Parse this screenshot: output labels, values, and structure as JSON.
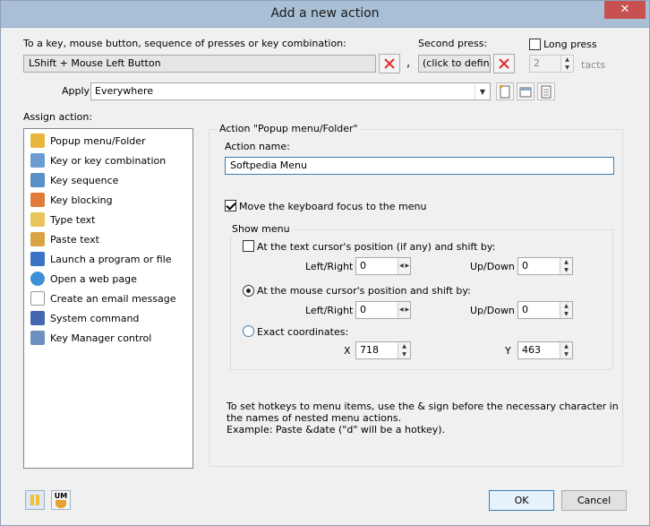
{
  "window": {
    "title": "Add a new action",
    "close_glyph": "✕"
  },
  "key": {
    "label": "To a key, mouse button, sequence of presses or key combination:",
    "value": "LShift + Mouse Left Button",
    "separator": ","
  },
  "second_press": {
    "label": "Second press:",
    "value": "(click to define)"
  },
  "long_press": {
    "label": "Long press",
    "checked": false,
    "tacts_value": "2",
    "tacts_label": "tacts"
  },
  "apply": {
    "label": "Apply",
    "value": "Everywhere"
  },
  "assign": {
    "label": "Assign action:",
    "items": [
      {
        "label": "Popup menu/Folder",
        "icon": "folder-icon",
        "color": "#e8b63c"
      },
      {
        "label": "Key or key combination",
        "icon": "key-icon",
        "color": "#6b9bd1"
      },
      {
        "label": "Key sequence",
        "icon": "key-sequence-icon",
        "color": "#5b8fc7"
      },
      {
        "label": "Key blocking",
        "icon": "key-blocking-icon",
        "color": "#e07b39"
      },
      {
        "label": "Type text",
        "icon": "type-text-icon",
        "color": "#e8c45a"
      },
      {
        "label": "Paste text",
        "icon": "paste-text-icon",
        "color": "#d9a441"
      },
      {
        "label": "Launch a program or file",
        "icon": "launch-program-icon",
        "color": "#3b73c4"
      },
      {
        "label": "Open a web page",
        "icon": "web-page-icon",
        "color": "#3f8fd6"
      },
      {
        "label": "Create an email message",
        "icon": "email-icon",
        "color": "#c8c8c8"
      },
      {
        "label": "System command",
        "icon": "system-command-icon",
        "color": "#4468b0"
      },
      {
        "label": "Key Manager control",
        "icon": "key-manager-icon",
        "color": "#6e8fbf"
      }
    ]
  },
  "action_group": {
    "title": "Action \"Popup menu/Folder\"",
    "name_label": "Action name:",
    "name_value": "Softpedia Menu",
    "focus_label": "Move the keyboard focus to the menu",
    "focus_checked": true
  },
  "show_menu": {
    "title": "Show menu",
    "text_cursor_label": "At the text cursor's position (if any) and shift by:",
    "text_cursor_checked": false,
    "left_right_label": "Left/Right",
    "up_down_label": "Up/Down",
    "text_lr": "0",
    "text_ud": "0",
    "mouse_label": "At the mouse cursor's position and shift by:",
    "mouse_lr": "0",
    "mouse_ud": "0",
    "exact_label": "Exact coordinates:",
    "x_label": "X",
    "y_label": "Y",
    "x_value": "718",
    "y_value": "463"
  },
  "hint": {
    "line1": "To set hotkeys to menu items, use the & sign before the necessary character in",
    "line2": "the names of nested menu actions.",
    "line3": "Example: Paste &date (\"d\" will be a hotkey)."
  },
  "footer": {
    "um_label": "UM",
    "ok_label": "OK",
    "cancel_label": "Cancel"
  },
  "colors": {
    "accent": "#3c7fb1",
    "close": "#c75050",
    "clear_x": "#d9302c",
    "titlebar": "#a9bfd6"
  }
}
